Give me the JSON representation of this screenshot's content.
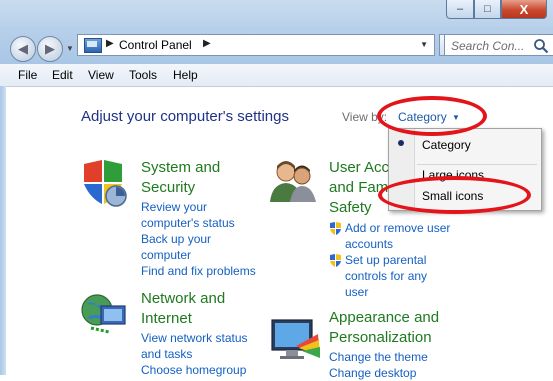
{
  "window": {
    "caption_buttons": {
      "minimize": "–",
      "maximize": "□",
      "close": "X"
    }
  },
  "navigation": {
    "back_icon": "arrow-left-icon",
    "forward_icon": "arrow-right-icon",
    "breadcrumb_sep": "▶",
    "address_location": "Control Panel",
    "search_placeholder": "Search Con..."
  },
  "menubar": {
    "items": [
      "File",
      "Edit",
      "View",
      "Tools",
      "Help"
    ]
  },
  "content": {
    "title": "Adjust your computer's settings",
    "view_by_label": "View by:",
    "view_by_value": "Category"
  },
  "categories": {
    "system_security": {
      "title_line1": "System and",
      "title_line2": "Security",
      "links": [
        "Review your",
        "computer's status",
        "Back up your",
        "computer",
        "Find and fix problems"
      ]
    },
    "network_internet": {
      "title_line1": "Network and",
      "title_line2": "Internet",
      "links": [
        "View network status",
        "and tasks",
        "Choose homegroup"
      ]
    },
    "user_accounts": {
      "title_line1": "User Acco",
      "title_line2": "and Fam",
      "title_line3": "Safety",
      "links": [
        "Add or remove user",
        "accounts",
        "Set up parental",
        "controls for any",
        "user"
      ]
    },
    "appearance": {
      "title_line1": "Appearance and",
      "title_line2": "Personalization",
      "links": [
        "Change the theme",
        "Change desktop"
      ]
    }
  },
  "dropdown": {
    "options": [
      "Category",
      "Large icons",
      "Small icons"
    ],
    "selected": "Category"
  },
  "colors": {
    "accent": "#1c5aa6",
    "category_green": "#1e7a1e",
    "annotation_red": "#e3141a"
  }
}
